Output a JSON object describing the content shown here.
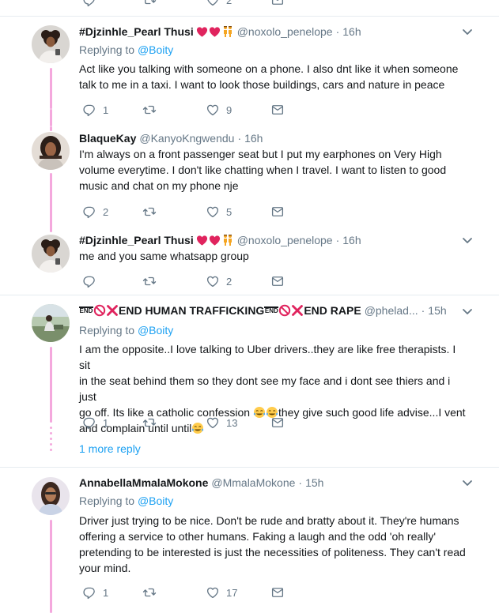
{
  "top_actions": {
    "like_count": "2"
  },
  "tweets": [
    {
      "name": "#Djzinhle_Pearl Thusi",
      "handle": "@noxolo_penelope",
      "time": "16h",
      "replying_prefix": "Replying to",
      "replying_to": "@Boity",
      "text": "Act like you talking with someone on a phone. I also dnt like it when someone talk to me in a taxi. I want to look those buildings, cars and nature in peace",
      "reply_count": "1",
      "like_count": "9"
    },
    {
      "name": "BlaqueKay",
      "handle": "@KanyoKngwendu",
      "time": "16h",
      "text": "I'm always on a front passenger seat but I put my earphones on Very High volume everytime. I don't like chatting when I travel. I want to listen to good music and chat on my phone nje",
      "reply_count": "2",
      "like_count": "5"
    },
    {
      "name": "#Djzinhle_Pearl Thusi",
      "handle": "@noxolo_penelope",
      "time": "16h",
      "text": "me and you same whatsapp group",
      "reply_count": "",
      "like_count": "2"
    },
    {
      "name_part1": "END HUMAN TRAFFICKING",
      "name_part2": "END RAPE",
      "end_label": "END",
      "handle": "@phelad...",
      "time": "15h",
      "replying_prefix": "Replying to",
      "replying_to": "@Boity",
      "text_line1": "I am the opposite..I love talking to Uber drivers..they are like free therapists. I sit",
      "text_line2": "in the seat behind them so they dont see my face and i dont see thiers and i just",
      "text_line3a": "go off. Its like a catholic confession ",
      "text_line3b": "they give such good life advise...I vent",
      "text_line4": "and complain until until",
      "reply_count": "1",
      "like_count": "13",
      "more_replies": "1 more reply"
    },
    {
      "name": "AnnabellaMmalaMokone",
      "handle": "@MmalaMokone",
      "time": "15h",
      "replying_prefix": "Replying to",
      "replying_to": "@Boity",
      "text": "Driver just trying to be nice. Don't be rude and bratty about it. They're humans offering a service to other humans. Faking a laugh and the odd 'oh really' pretending to be interested is just the necessities of politeness. They can't read your mind.",
      "reply_count": "1",
      "like_count": "17"
    }
  ],
  "colors": {
    "accent": "#1da1f2",
    "thread": "#f4a8dd",
    "muted": "#657786",
    "text": "#14171a",
    "border": "#e6ecf0"
  },
  "icons": [
    "reply-icon",
    "retweet-icon",
    "like-icon",
    "message-icon",
    "chevron-down-icon",
    "heart-emoji",
    "women-dancing-emoji",
    "no-entry-emoji",
    "cross-mark-emoji",
    "end-arrow-emoji",
    "tears-of-joy-emoji"
  ]
}
